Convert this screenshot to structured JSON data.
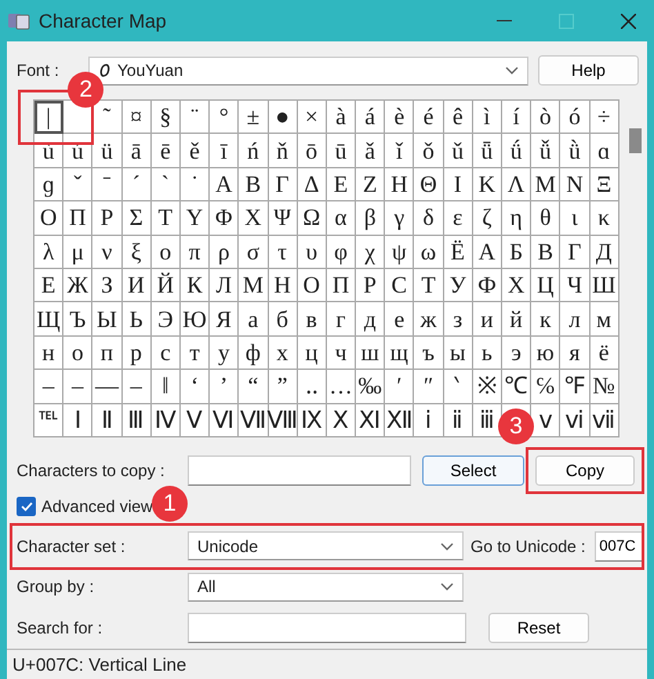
{
  "window": {
    "title": "Character Map"
  },
  "font": {
    "label": "Font :",
    "value": "YouYuan",
    "button": "Help"
  },
  "grid": {
    "rows": [
      [
        {
          "c": "|",
          "selected": true
        },
        {
          "selected": false
        },
        {
          "c": "˜",
          "selected": false
        },
        {
          "c": "¤",
          "selected": false
        },
        {
          "c": "§",
          "selected": false
        },
        {
          "c": "¨",
          "selected": false
        },
        {
          "c": "°",
          "selected": false
        },
        {
          "c": "±",
          "selected": false
        },
        {
          "c": "●",
          "selected": false
        },
        {
          "c": "×",
          "selected": false
        },
        {
          "c": "à",
          "selected": false
        },
        {
          "c": "á",
          "selected": false
        },
        {
          "c": "è",
          "selected": false
        },
        {
          "c": "é",
          "selected": false
        },
        {
          "c": "ê",
          "selected": false
        },
        {
          "c": "ì",
          "selected": false
        },
        {
          "c": "í",
          "selected": false
        },
        {
          "c": "ò",
          "selected": false
        },
        {
          "c": "ó",
          "selected": false
        },
        {
          "c": "÷",
          "selected": false
        }
      ],
      [
        {
          "c": "ù",
          "selected": false
        },
        {
          "c": "ú",
          "selected": false
        },
        {
          "c": "ü",
          "selected": false
        },
        {
          "c": "ā",
          "selected": false
        },
        {
          "c": "ē",
          "selected": false
        },
        {
          "c": "ě",
          "selected": false
        },
        {
          "c": "ī",
          "selected": false
        },
        {
          "c": "ń",
          "selected": false
        },
        {
          "c": "ň",
          "selected": false
        },
        {
          "c": "ō",
          "selected": false
        },
        {
          "c": "ū",
          "selected": false
        },
        {
          "c": "ǎ",
          "selected": false
        },
        {
          "c": "ǐ",
          "selected": false
        },
        {
          "c": "ǒ",
          "selected": false
        },
        {
          "c": "ǔ",
          "selected": false
        },
        {
          "c": "ǖ",
          "selected": false
        },
        {
          "c": "ǘ",
          "selected": false
        },
        {
          "c": "ǚ",
          "selected": false
        },
        {
          "c": "ǜ",
          "selected": false
        },
        {
          "c": "ɑ",
          "selected": false
        }
      ],
      [
        {
          "c": "ɡ",
          "selected": false
        },
        {
          "c": "ˇ",
          "selected": false
        },
        {
          "c": "ˉ",
          "selected": false
        },
        {
          "c": "ˊ",
          "selected": false
        },
        {
          "c": "ˋ",
          "selected": false
        },
        {
          "c": "˙",
          "selected": false
        },
        {
          "c": "Α",
          "selected": false
        },
        {
          "c": "Β",
          "selected": false
        },
        {
          "c": "Γ",
          "selected": false
        },
        {
          "c": "Δ",
          "selected": false
        },
        {
          "c": "Ε",
          "selected": false
        },
        {
          "c": "Ζ",
          "selected": false
        },
        {
          "c": "Η",
          "selected": false
        },
        {
          "c": "Θ",
          "selected": false
        },
        {
          "c": "Ι",
          "selected": false
        },
        {
          "c": "Κ",
          "selected": false
        },
        {
          "c": "Λ",
          "selected": false
        },
        {
          "c": "Μ",
          "selected": false
        },
        {
          "c": "Ν",
          "selected": false
        },
        {
          "c": "Ξ",
          "selected": false
        }
      ],
      [
        {
          "c": "Ο",
          "selected": false
        },
        {
          "c": "Π",
          "selected": false
        },
        {
          "c": "Ρ",
          "selected": false
        },
        {
          "c": "Σ",
          "selected": false
        },
        {
          "c": "Τ",
          "selected": false
        },
        {
          "c": "Υ",
          "selected": false
        },
        {
          "c": "Φ",
          "selected": false
        },
        {
          "c": "Χ",
          "selected": false
        },
        {
          "c": "Ψ",
          "selected": false
        },
        {
          "c": "Ω",
          "selected": false
        },
        {
          "c": "α",
          "selected": false
        },
        {
          "c": "β",
          "selected": false
        },
        {
          "c": "γ",
          "selected": false
        },
        {
          "c": "δ",
          "selected": false
        },
        {
          "c": "ε",
          "selected": false
        },
        {
          "c": "ζ",
          "selected": false
        },
        {
          "c": "η",
          "selected": false
        },
        {
          "c": "θ",
          "selected": false
        },
        {
          "c": "ι",
          "selected": false
        },
        {
          "c": "κ",
          "selected": false
        }
      ],
      [
        {
          "c": "λ",
          "selected": false
        },
        {
          "c": "μ",
          "selected": false
        },
        {
          "c": "ν",
          "selected": false
        },
        {
          "c": "ξ",
          "selected": false
        },
        {
          "c": "ο",
          "selected": false
        },
        {
          "c": "π",
          "selected": false
        },
        {
          "c": "ρ",
          "selected": false
        },
        {
          "c": "σ",
          "selected": false
        },
        {
          "c": "τ",
          "selected": false
        },
        {
          "c": "υ",
          "selected": false
        },
        {
          "c": "φ",
          "selected": false
        },
        {
          "c": "χ",
          "selected": false
        },
        {
          "c": "ψ",
          "selected": false
        },
        {
          "c": "ω",
          "selected": false
        },
        {
          "c": "Ё",
          "selected": false
        },
        {
          "c": "А",
          "selected": false
        },
        {
          "c": "Б",
          "selected": false
        },
        {
          "c": "В",
          "selected": false
        },
        {
          "c": "Г",
          "selected": false
        },
        {
          "c": "Д",
          "selected": false
        }
      ],
      [
        {
          "c": "Е",
          "selected": false
        },
        {
          "c": "Ж",
          "selected": false
        },
        {
          "c": "З",
          "selected": false
        },
        {
          "c": "И",
          "selected": false
        },
        {
          "c": "Й",
          "selected": false
        },
        {
          "c": "К",
          "selected": false
        },
        {
          "c": "Л",
          "selected": false
        },
        {
          "c": "М",
          "selected": false
        },
        {
          "c": "Н",
          "selected": false
        },
        {
          "c": "О",
          "selected": false
        },
        {
          "c": "П",
          "selected": false
        },
        {
          "c": "Р",
          "selected": false
        },
        {
          "c": "С",
          "selected": false
        },
        {
          "c": "Т",
          "selected": false
        },
        {
          "c": "У",
          "selected": false
        },
        {
          "c": "Ф",
          "selected": false
        },
        {
          "c": "Х",
          "selected": false
        },
        {
          "c": "Ц",
          "selected": false
        },
        {
          "c": "Ч",
          "selected": false
        },
        {
          "c": "Ш",
          "selected": false
        }
      ],
      [
        {
          "c": "Щ",
          "selected": false
        },
        {
          "c": "Ъ",
          "selected": false
        },
        {
          "c": "Ы",
          "selected": false
        },
        {
          "c": "Ь",
          "selected": false
        },
        {
          "c": "Э",
          "selected": false
        },
        {
          "c": "Ю",
          "selected": false
        },
        {
          "c": "Я",
          "selected": false
        },
        {
          "c": "а",
          "selected": false
        },
        {
          "c": "б",
          "selected": false
        },
        {
          "c": "в",
          "selected": false
        },
        {
          "c": "г",
          "selected": false
        },
        {
          "c": "д",
          "selected": false
        },
        {
          "c": "е",
          "selected": false
        },
        {
          "c": "ж",
          "selected": false
        },
        {
          "c": "з",
          "selected": false
        },
        {
          "c": "и",
          "selected": false
        },
        {
          "c": "й",
          "selected": false
        },
        {
          "c": "к",
          "selected": false
        },
        {
          "c": "л",
          "selected": false
        },
        {
          "c": "м",
          "selected": false
        }
      ],
      [
        {
          "c": "н",
          "selected": false
        },
        {
          "c": "о",
          "selected": false
        },
        {
          "c": "п",
          "selected": false
        },
        {
          "c": "р",
          "selected": false
        },
        {
          "c": "с",
          "selected": false
        },
        {
          "c": "т",
          "selected": false
        },
        {
          "c": "у",
          "selected": false
        },
        {
          "c": "ф",
          "selected": false
        },
        {
          "c": "х",
          "selected": false
        },
        {
          "c": "ц",
          "selected": false
        },
        {
          "c": "ч",
          "selected": false
        },
        {
          "c": "ш",
          "selected": false
        },
        {
          "c": "щ",
          "selected": false
        },
        {
          "c": "ъ",
          "selected": false
        },
        {
          "c": "ы",
          "selected": false
        },
        {
          "c": "ь",
          "selected": false
        },
        {
          "c": "э",
          "selected": false
        },
        {
          "c": "ю",
          "selected": false
        },
        {
          "c": "я",
          "selected": false
        },
        {
          "c": "ё",
          "selected": false
        }
      ],
      [
        {
          "c": "–",
          "selected": false
        },
        {
          "c": "–",
          "selected": false
        },
        {
          "c": "—",
          "selected": false
        },
        {
          "c": "–",
          "selected": false
        },
        {
          "c": "‖",
          "selected": false
        },
        {
          "c": "‘",
          "selected": false
        },
        {
          "c": "’",
          "selected": false
        },
        {
          "c": "“",
          "selected": false
        },
        {
          "c": "”",
          "selected": false
        },
        {
          "c": "‥",
          "selected": false
        },
        {
          "c": "…",
          "selected": false
        },
        {
          "c": "‰",
          "selected": false
        },
        {
          "c": "′",
          "selected": false
        },
        {
          "c": "″",
          "selected": false
        },
        {
          "c": "‵",
          "selected": false
        },
        {
          "c": "※",
          "selected": false
        },
        {
          "c": "℃",
          "selected": false
        },
        {
          "c": "℅",
          "selected": false
        },
        {
          "c": "℉",
          "selected": false
        },
        {
          "c": "№",
          "selected": false
        }
      ],
      [
        {
          "c": "℡",
          "selected": false
        },
        {
          "c": "Ⅰ",
          "selected": false
        },
        {
          "c": "Ⅱ",
          "selected": false
        },
        {
          "c": "Ⅲ",
          "selected": false
        },
        {
          "c": "Ⅳ",
          "selected": false
        },
        {
          "c": "Ⅴ",
          "selected": false
        },
        {
          "c": "Ⅵ",
          "selected": false
        },
        {
          "c": "Ⅶ",
          "selected": false
        },
        {
          "c": "Ⅷ",
          "selected": false
        },
        {
          "c": "Ⅸ",
          "selected": false
        },
        {
          "c": "Ⅹ",
          "selected": false
        },
        {
          "c": "Ⅺ",
          "selected": false
        },
        {
          "c": "Ⅻ",
          "selected": false
        },
        {
          "c": "ⅰ",
          "selected": false
        },
        {
          "c": "ⅱ",
          "selected": false
        },
        {
          "c": "ⅲ",
          "selected": false
        },
        {
          "selected": false
        },
        {
          "c": "ⅴ",
          "selected": false
        },
        {
          "c": "ⅵ",
          "selected": false
        },
        {
          "c": "ⅶ",
          "selected": false
        }
      ]
    ]
  },
  "characters_to_copy": {
    "label": "Characters to copy :",
    "select_button": "Select",
    "copy_button": "Copy"
  },
  "advanced_view": {
    "label": "Advanced view",
    "checked": true
  },
  "character_set": {
    "label": "Character set :",
    "value": "Unicode"
  },
  "go_to_unicode": {
    "label": "Go to Unicode :",
    "value": "007C"
  },
  "group_by": {
    "label": "Group by :",
    "value": "All"
  },
  "search_for": {
    "label": "Search for :",
    "button": "Reset"
  },
  "status_bar": "U+007C: Vertical Line",
  "annotations": [
    {
      "number": "2"
    },
    {
      "number": "3"
    },
    {
      "number": "1"
    }
  ]
}
